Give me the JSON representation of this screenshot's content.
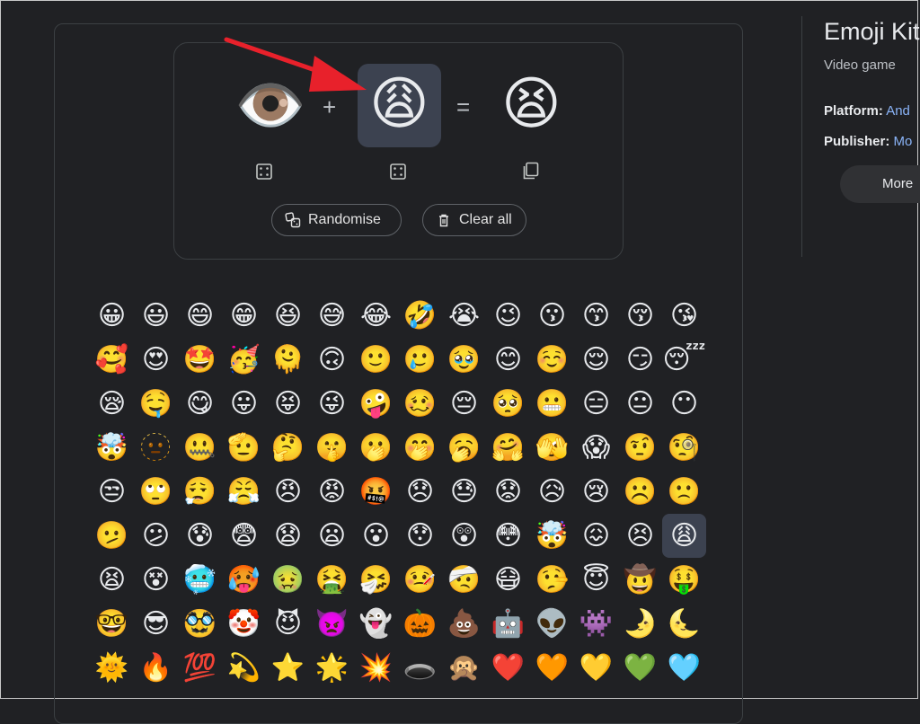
{
  "combiner": {
    "left_emoji": "👁️",
    "plus": "+",
    "selected_emoji": "😩",
    "equals": "=",
    "result_emoji": "😫",
    "randomise_label": "Randomise",
    "clear_label": "Clear all"
  },
  "emoji_grid": {
    "rows": [
      [
        "😀",
        "😃",
        "😄",
        "😁",
        "😆",
        "😅",
        "😂",
        "🤣",
        "😭",
        "😉",
        "😗",
        "😙",
        "😚",
        "😘"
      ],
      [
        "🥰",
        "😍",
        "🤩",
        "🥳",
        "🫠",
        "🙃",
        "🙂",
        "🥲",
        "🥹",
        "😊",
        "☺️",
        "😌",
        "😏",
        "😴"
      ],
      [
        "😪",
        "🤤",
        "😋",
        "😛",
        "😝",
        "😜",
        "🤪",
        "🥴",
        "😔",
        "🥺",
        "😬",
        "😑",
        "😐",
        "😶"
      ],
      [
        "🤯",
        "🫥",
        "🤐",
        "🫡",
        "🤔",
        "🤫",
        "🫢",
        "🤭",
        "🥱",
        "🤗",
        "🫣",
        "😱",
        "🤨",
        "🧐"
      ],
      [
        "😒",
        "🙄",
        "😮‍💨",
        "😤",
        "😠",
        "😡",
        "🤬",
        "😞",
        "😓",
        "😟",
        "😥",
        "😢",
        "☹️",
        "🙁"
      ],
      [
        "🫤",
        "😕",
        "😰",
        "😨",
        "😧",
        "😦",
        "😮",
        "😯",
        "😲",
        "😳",
        "🤯",
        "😖",
        "😣",
        "😩"
      ],
      [
        "😫",
        "😵",
        "🥶",
        "🥵",
        "🤢",
        "🤮",
        "🤧",
        "🤒",
        "🤕",
        "😷",
        "🤥",
        "😇",
        "🤠",
        "🤑"
      ],
      [
        "🤓",
        "😎",
        "🥸",
        "🤡",
        "😈",
        "👿",
        "👻",
        "🎃",
        "💩",
        "🤖",
        "👽",
        "👾",
        "🌛",
        "🌜"
      ],
      [
        "🌞",
        "🔥",
        "💯",
        "💫",
        "⭐",
        "🌟",
        "💥",
        "🕳️",
        "🙊",
        "❤️",
        "🧡",
        "💛",
        "💚",
        "🩵"
      ]
    ],
    "selected_index": [
      5,
      13
    ]
  },
  "knowledge_panel": {
    "title": "Emoji Kit",
    "subtitle": "Video game",
    "platform_label": "Platform:",
    "platform_value": "And",
    "publisher_label": "Publisher:",
    "publisher_value": "Mo",
    "more_label": "More"
  },
  "colors": {
    "background": "#202124",
    "selected_bg": "#3c4250",
    "arrow": "#e8212b",
    "link": "#8ab4f8"
  }
}
